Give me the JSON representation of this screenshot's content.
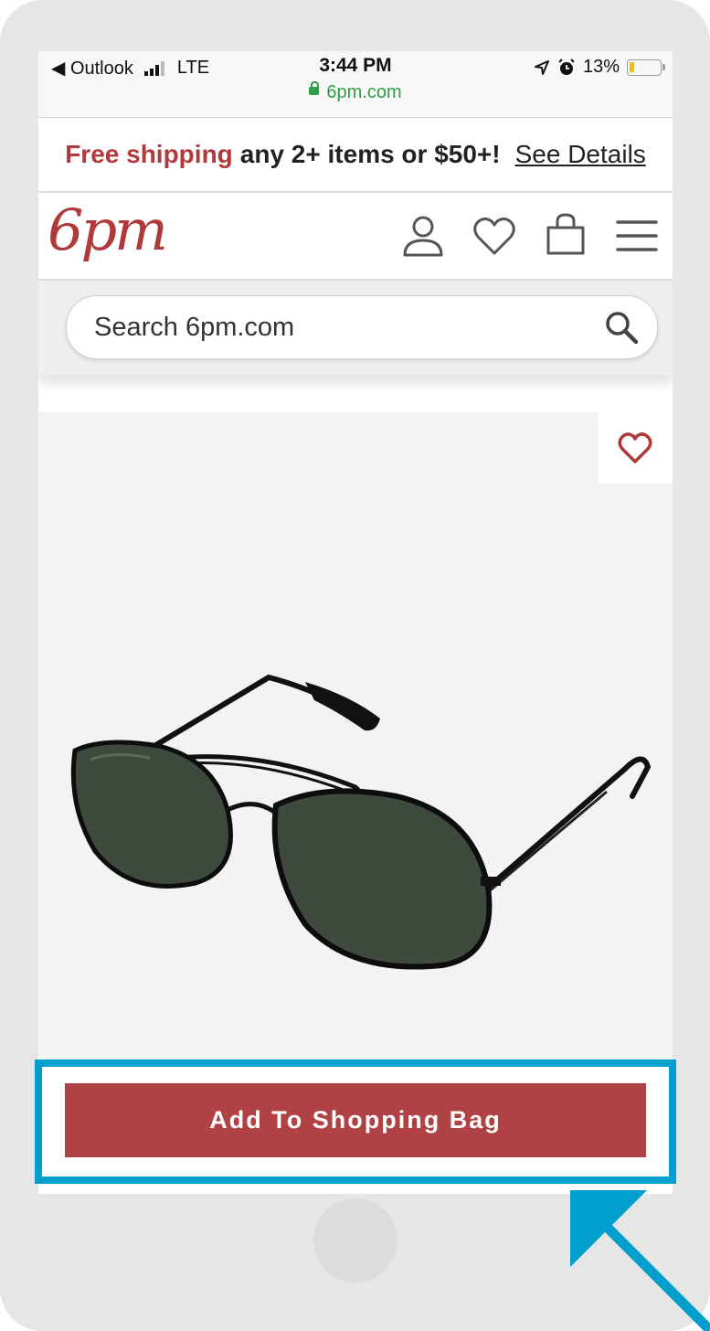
{
  "status_bar": {
    "back_label": "◀ Outlook",
    "network": "LTE",
    "time": "3:44 PM",
    "url": "6pm.com",
    "battery": "13%",
    "battery_level": 0.13
  },
  "promo": {
    "highlight": "Free shipping",
    "text": "any 2+ items or $50+!",
    "link": "See Details"
  },
  "header": {
    "logo": "6pm",
    "icons": [
      "account-icon",
      "heart-icon",
      "shopping-bag-icon",
      "menu-icon"
    ]
  },
  "search": {
    "placeholder": "Search 6pm.com"
  },
  "product": {
    "image_icon": "sunglasses-image",
    "favorite_icon": "heart-icon"
  },
  "cta": {
    "add_to_bag": "Add To Shopping Bag"
  },
  "colors": {
    "brand": "#b0393b",
    "button": "#b04245",
    "highlight": "#009fcd",
    "secure": "#2f9e44"
  }
}
